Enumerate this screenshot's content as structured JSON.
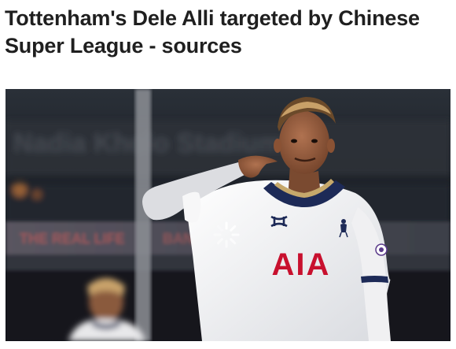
{
  "article": {
    "headline": "Tottenham's Dele Alli targeted by Chinese Super League - sources"
  },
  "hero_image": {
    "shirt_sponsor": "AIA",
    "brand_mark": "under-armour-logo",
    "crest": "spurs-cockerel-crest",
    "overlay_icon": "loading-spinner-icon"
  },
  "colors": {
    "headline": "#1f1f1f",
    "shirt": "#f4f4f4",
    "collar": "#1d2a57",
    "sponsor": "#c8102e",
    "background": "#1b1f25"
  }
}
